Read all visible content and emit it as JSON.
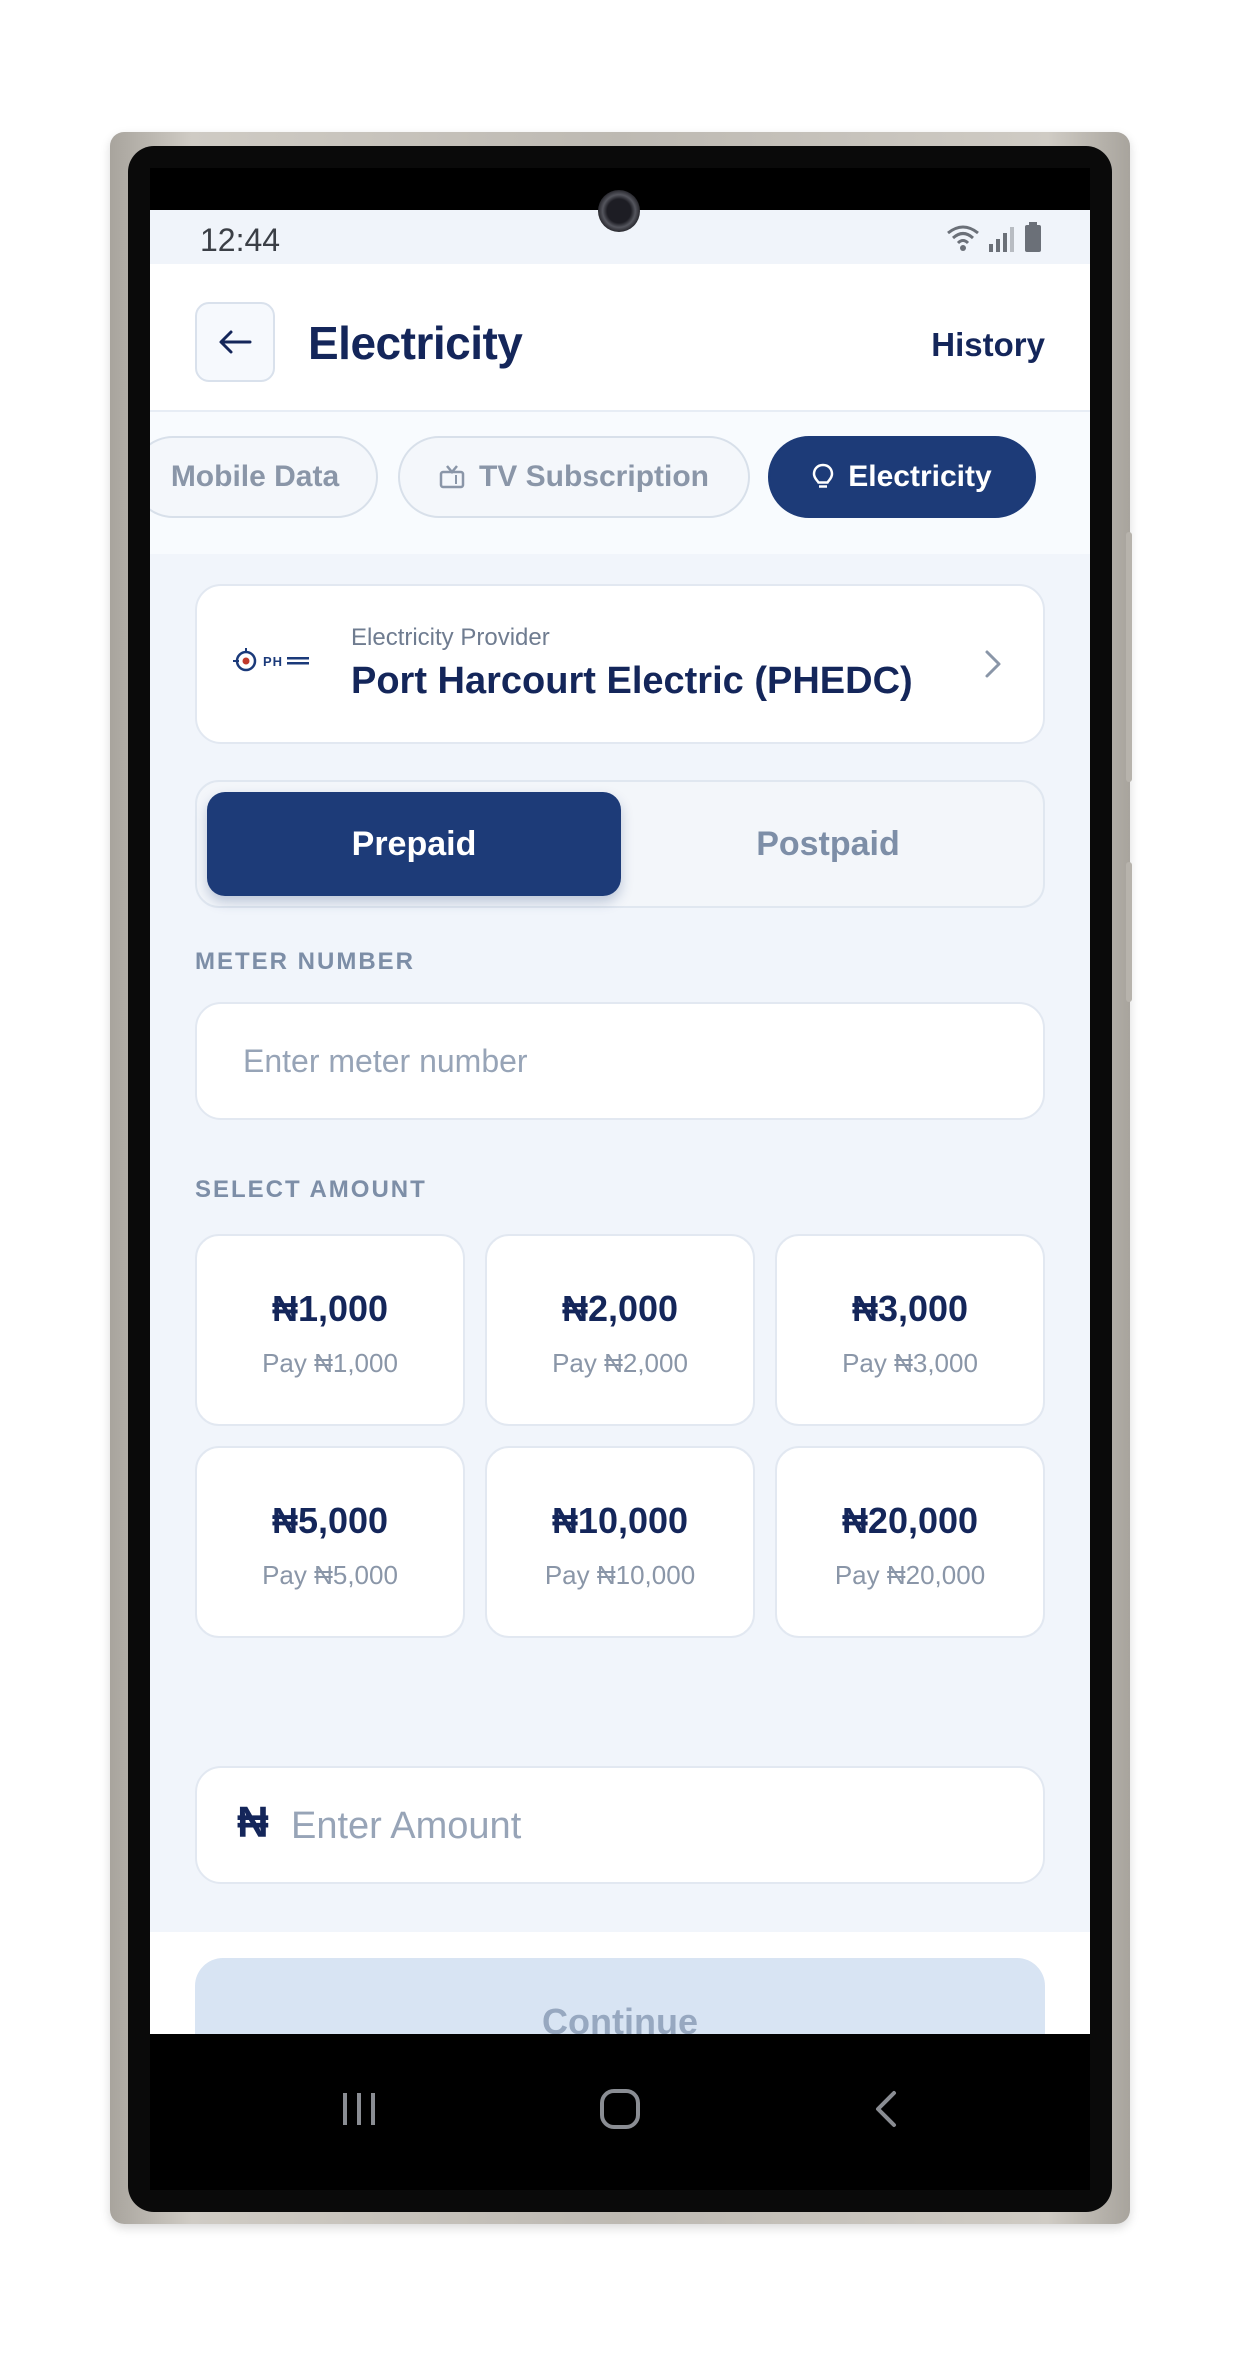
{
  "status_bar": {
    "time": "12:44",
    "icons": [
      "wifi-icon",
      "signal-icon",
      "battery-icon"
    ]
  },
  "header": {
    "title": "Electricity",
    "history_label": "History",
    "back_icon": "arrow-left-icon"
  },
  "category_tabs": [
    {
      "label": "Mobile Data",
      "icon": "",
      "active": false
    },
    {
      "label": "TV Subscription",
      "icon": "tv-icon",
      "active": false
    },
    {
      "label": "Electricity",
      "icon": "lightbulb-icon",
      "active": true
    }
  ],
  "provider": {
    "caption": "Electricity Provider",
    "name": "Port Harcourt Electric (PHEDC)",
    "logo_text": "PH"
  },
  "plan_toggle": {
    "options": [
      "Prepaid",
      "Postpaid"
    ],
    "selected": "Prepaid"
  },
  "meter": {
    "label": "METER NUMBER",
    "placeholder": "Enter meter number",
    "value": ""
  },
  "amounts": {
    "label": "SELECT AMOUNT",
    "options": [
      {
        "value": "₦1,000",
        "pay": "Pay ₦1,000"
      },
      {
        "value": "₦2,000",
        "pay": "Pay ₦2,000"
      },
      {
        "value": "₦3,000",
        "pay": "Pay ₦3,000"
      },
      {
        "value": "₦5,000",
        "pay": "Pay ₦5,000"
      },
      {
        "value": "₦10,000",
        "pay": "Pay ₦10,000"
      },
      {
        "value": "₦20,000",
        "pay": "Pay ₦20,000"
      }
    ]
  },
  "custom_amount": {
    "currency_symbol": "₦",
    "placeholder": "Enter Amount",
    "value": ""
  },
  "continue_label": "Continue",
  "colors": {
    "primary": "#1d3b78",
    "title_text": "#14265a",
    "muted_text": "#8a96a8",
    "page_bg": "#f1f5fb",
    "disabled_button": "#d8e4f3"
  }
}
